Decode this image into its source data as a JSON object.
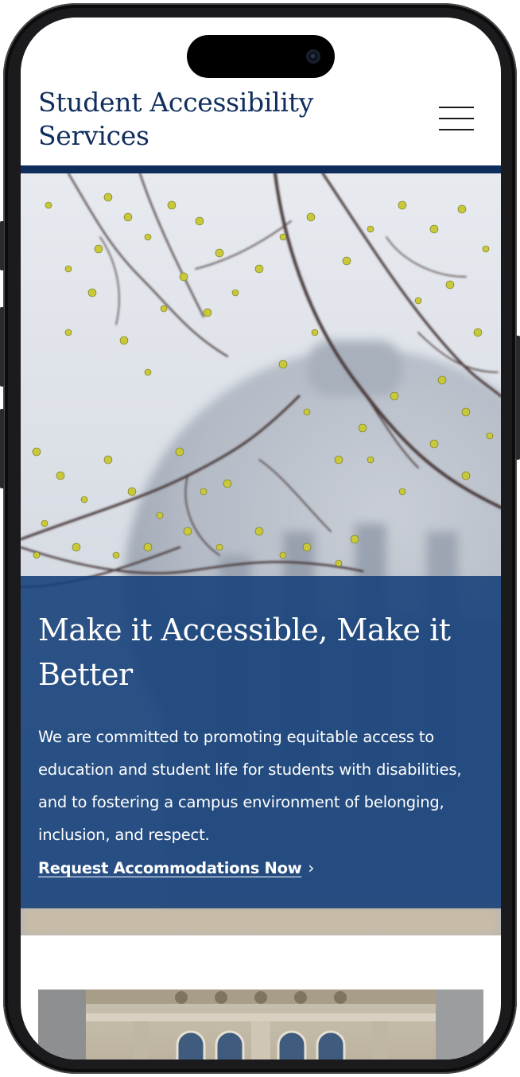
{
  "site": {
    "title": "Student Accessibility Services"
  },
  "header": {
    "menu_icon": "hamburger-menu-icon"
  },
  "hero": {
    "heading": "Make it Accessible, Make it Better",
    "body": "We are committed to promoting equitable access to education and student life for students with disabilities, and to fostering a campus environment of belonging, inclusion, and respect.",
    "cta_label": "Request Accommodations Now",
    "cta_icon": "chevron-right-icon"
  },
  "colors": {
    "brand_navy": "#102e5c",
    "panel_blue": "#18427b",
    "header_rule": "#0f2d5a"
  }
}
